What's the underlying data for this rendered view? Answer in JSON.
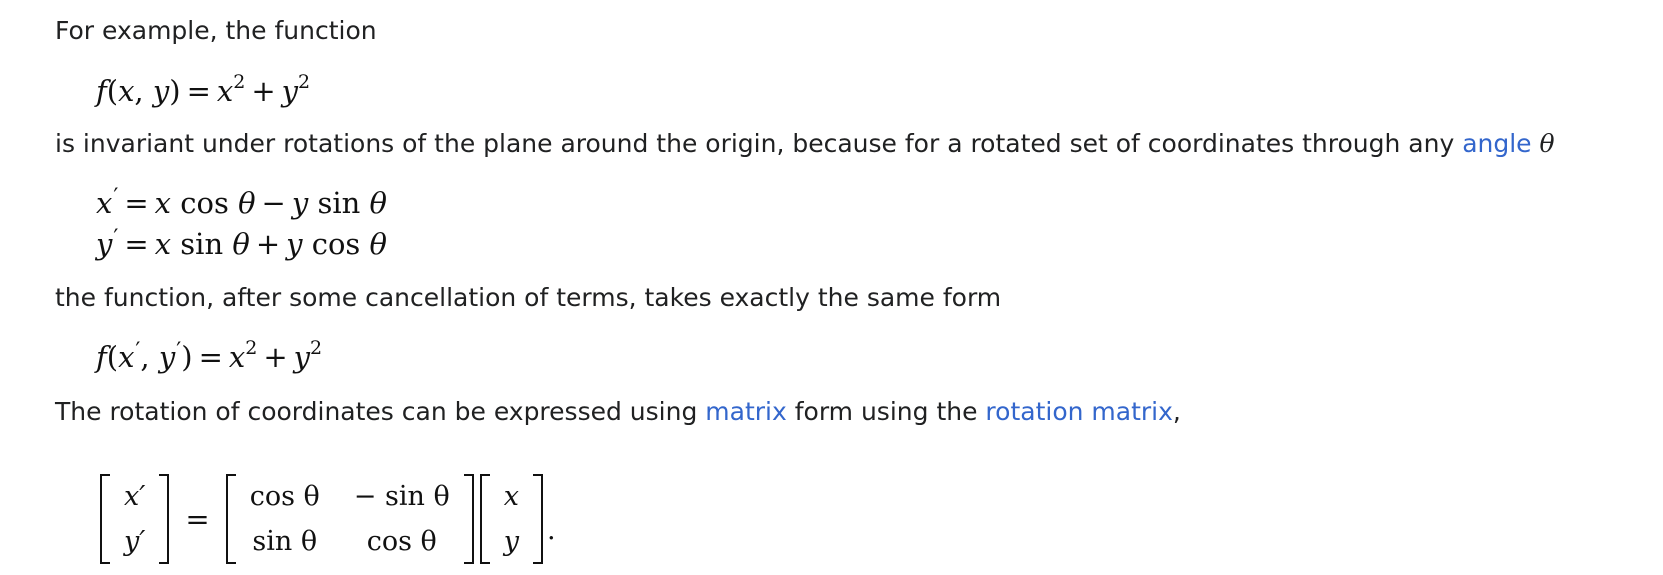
{
  "paragraphs": {
    "p1": "For example, the function",
    "p2_before": "is invariant under rotations of the plane around the origin, because for a rotated set of coordinates through any ",
    "p2_link": "angle",
    "p2_symbol": "θ",
    "p3": "the function, after some cancellation of terms, takes exactly the same form",
    "p4_before": "The rotation of coordinates can be expressed using ",
    "p4_link1": "matrix",
    "p4_middle": " form using the ",
    "p4_link2": "rotation matrix",
    "p4_after": ","
  },
  "equations": {
    "eq1": "f(x,y) = x² + y²",
    "eq2_line1": "x′ = x cos θ − y sin θ",
    "eq2_line2": "y′ = x sin θ + y cos θ",
    "eq3": "f(x′,y′) = x² + y²",
    "eq4": {
      "lhs": [
        "x′",
        "y′"
      ],
      "rotation_matrix": [
        [
          "cos θ",
          "− sin θ"
        ],
        [
          "sin θ",
          "cos θ"
        ]
      ],
      "rhs": [
        "x",
        "y"
      ],
      "end": "."
    }
  },
  "colors": {
    "text": "#202122",
    "link": "#3366cc"
  }
}
